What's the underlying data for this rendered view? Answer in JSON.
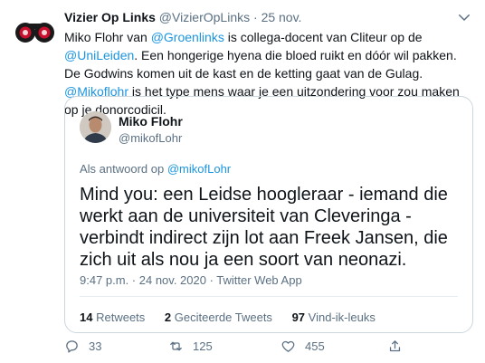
{
  "tweet": {
    "author_name": "Vizier Op Links",
    "author_handle": "@VizierOpLinks",
    "separator": "·",
    "date": "25 nov.",
    "body": [
      {
        "text": "Miko Flohr van ",
        "link": false
      },
      {
        "text": "@Groenlinks",
        "link": true
      },
      {
        "text": " is collega-docent van Cliteur op de ",
        "link": false
      },
      {
        "text": "@UniLeiden",
        "link": true
      },
      {
        "text": ". Een hongerige hyena die bloed ruikt en dóór wil pakken. De Godwins komen uit de kast en de ketting gaat van de Gulag. ",
        "link": false
      },
      {
        "text": "@Mikoflohr",
        "link": true
      },
      {
        "text": " is het type mens waar je een uitzondering voor zou maken op je donorcodicil.",
        "link": false
      }
    ],
    "actions": {
      "replies": "33",
      "retweets": "125",
      "likes": "455"
    }
  },
  "quoted": {
    "author_name": "Miko Flohr",
    "author_handle": "@mikofLohr",
    "reply_prefix": "Als antwoord op",
    "reply_to": "@mikofLohr",
    "text": "Mind you: een Leidse hoogleraar - iemand die werkt aan de universiteit van Cleveringa - verbindt indirect zijn lot aan Freek Jansen, die zich uit als nou ja een soort van neonazi.",
    "timestamp": "9:47 p.m. · 24 nov. 2020 · Twitter Web App",
    "stats": [
      {
        "count": "14",
        "label": "Retweets"
      },
      {
        "count": "2",
        "label": "Geciteerde Tweets"
      },
      {
        "count": "97",
        "label": "Vind-ik-leuks"
      }
    ]
  },
  "colors": {
    "link": "#1b95e0",
    "secondary_text": "#5b7083",
    "border": "#ccd6dd"
  }
}
